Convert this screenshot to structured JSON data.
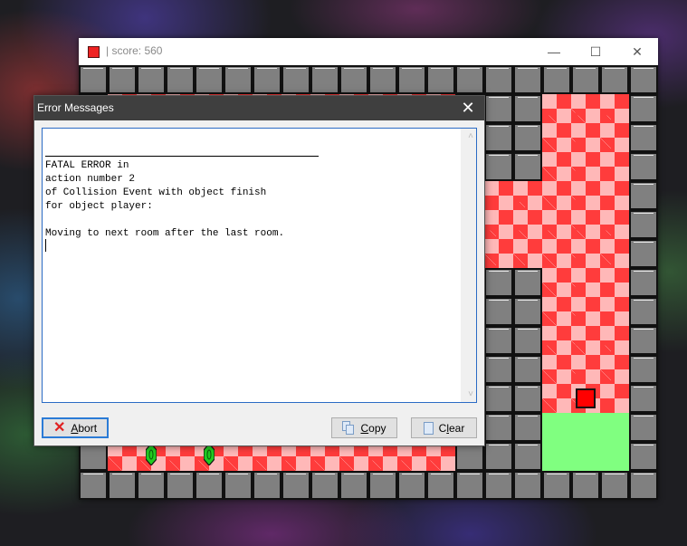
{
  "game_window": {
    "title": "| score: 560",
    "icon": "red-square-icon",
    "controls": {
      "minimize": "—",
      "maximize": "☐",
      "close": "✕"
    },
    "room": {
      "tile_size_note": "grid of 20 columns x 15 rows",
      "layout": [
        "WWWWWWWWWWWWWWWWWWWW",
        "WCCCCCCCCCCCCWWWCCCW",
        "W????????????WWWCCCW",
        "W????????????WWWCCCW",
        "W????????????CCCCCCW",
        "W????????????CCCCCCW",
        "W????????????CCCCCCW",
        "W????????????WWWCCCW",
        "W????????????WWWCCCW",
        "W????????????WWWCCCW",
        "W????????????WWWCCCW",
        "W????????????WWWCCCW",
        "W????????????WWWFFFW",
        "WCCCCCCCCCCCCWWWFFFW",
        "WWWWWWWWWWWWWWWWWWWW"
      ],
      "legend": {
        "W": "wall",
        "C": "checker-floor",
        "F": "finish",
        "?": "hidden-behind-dialog"
      },
      "player": {
        "col": 17,
        "row": 11
      },
      "gems": [
        {
          "col": 2,
          "row": 13
        },
        {
          "col": 4,
          "row": 13
        }
      ],
      "colors": {
        "wall": "#808080",
        "checker_dark": "#ff3c3c",
        "checker_light": "#ffb8b8",
        "finish": "#80ff80",
        "player": "#ff0000",
        "gem": "#22cc22"
      }
    }
  },
  "dialog": {
    "title": "Error Messages",
    "close_label": "✕",
    "message_lines": [
      "FATAL ERROR in",
      "action number 2",
      "of Collision Event with object finish",
      "for object player:",
      "",
      "Moving to next room after the last room."
    ],
    "buttons": {
      "abort": {
        "label": "Abort",
        "mnemonic": "A",
        "rest": "bort",
        "icon": "x-icon"
      },
      "copy": {
        "label": "Copy",
        "mnemonic": "C",
        "rest": "opy",
        "icon": "copy-icon"
      },
      "clear": {
        "label": "Clear",
        "mnemonic": "l",
        "pre": "C",
        "rest": "ear",
        "icon": "document-icon"
      }
    },
    "scroll": {
      "up": "˄",
      "down": "˅"
    }
  }
}
